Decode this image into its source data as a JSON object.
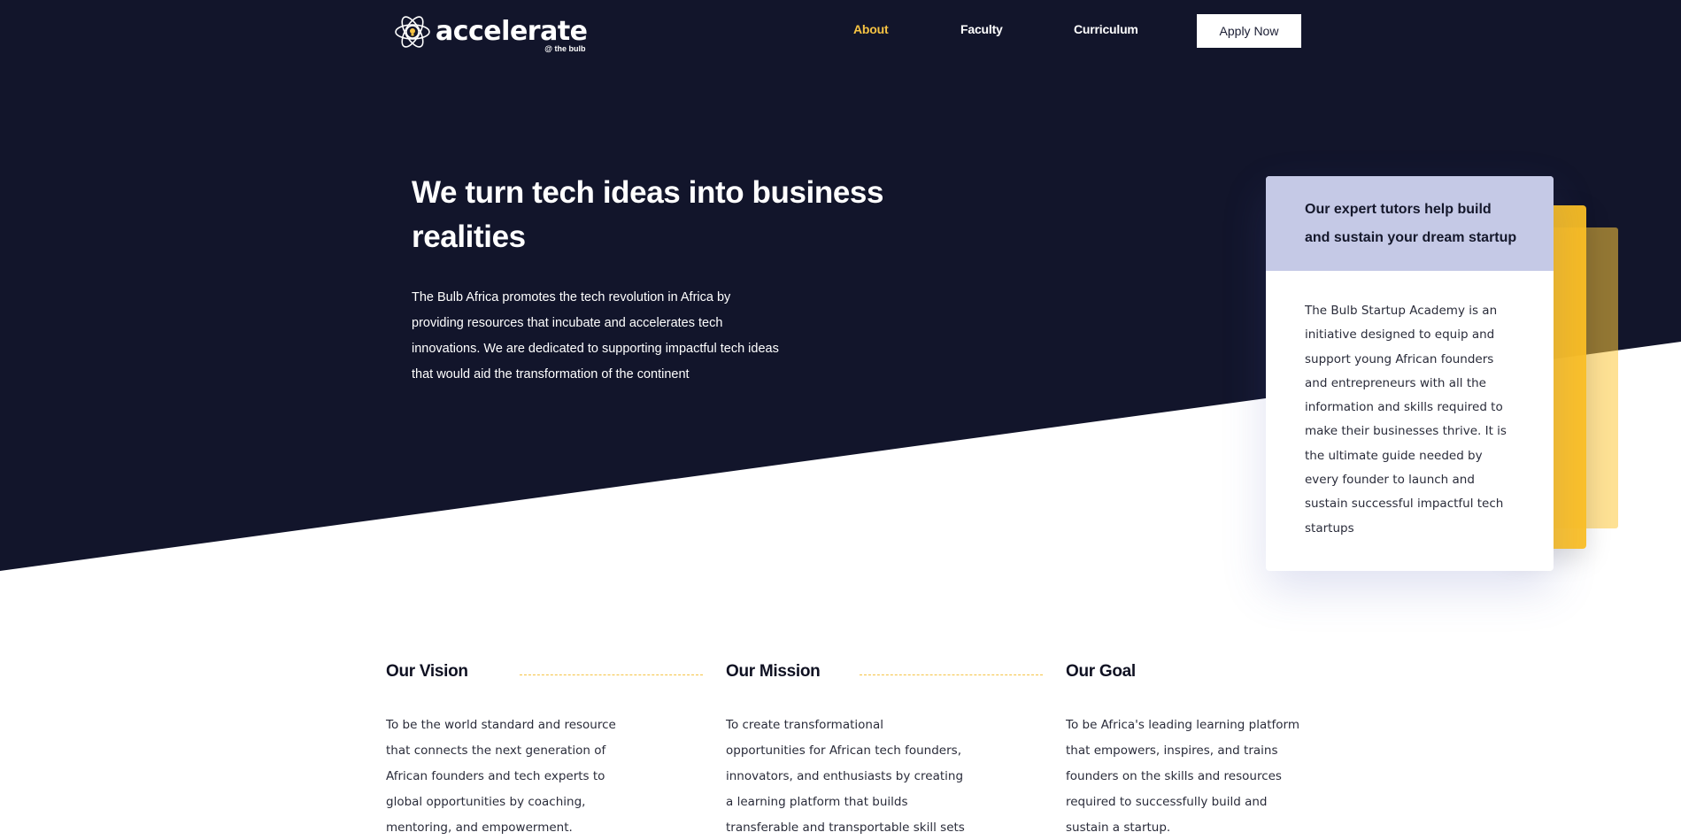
{
  "nav": {
    "logo": {
      "word": "accelerate",
      "sub": "@ the bulb"
    },
    "links": [
      "About",
      "Faculty",
      "Curriculum"
    ],
    "active_link": "About",
    "apply_label": "Apply Now"
  },
  "hero": {
    "title_line1": "We turn tech ideas into business",
    "title_line2": "realities",
    "text_lines": [
      "The Bulb Africa promotes the tech revolution in Africa by",
      "providing resources that incubate and accelerates tech",
      "innovations. We are dedicated to supporting impactful tech ideas",
      "that would aid the transformation of the continent"
    ]
  },
  "card": {
    "heading_lines": [
      "Our expert tutors help build",
      "and sustain your dream startup"
    ],
    "body_lines": [
      "The Bulb Startup Academy is an",
      "initiative designed to equip and",
      "support young African founders",
      "and entrepreneurs with all the",
      "information and skills required to",
      "make their businesses thrive. It is",
      "the ultimate guide needed by",
      "every founder to launch and",
      "sustain successful impactful tech",
      "startups"
    ]
  },
  "columns": [
    {
      "title": "Our Vision",
      "lines": [
        "To be the world standard and resource",
        "that connects the next generation of",
        "African founders and tech experts to",
        "global opportunities by coaching,",
        "mentoring, and empowerment."
      ]
    },
    {
      "title": "Our Mission",
      "lines": [
        "To create transformational",
        "opportunities for African tech founders,",
        "innovators, and enthusiasts by creating",
        "a learning platform that builds",
        "transferable and transportable skill sets"
      ]
    },
    {
      "title": "Our Goal",
      "lines": [
        "To be Africa's leading learning platform",
        "that empowers, inspires, and trains",
        "founders on the skills and resources",
        "required to successfully build and",
        "sustain a startup."
      ]
    }
  ],
  "colors": {
    "navy": "#12152b",
    "accent_yellow": "#f6c343",
    "card_header": "#c5c9e6"
  },
  "icons": {
    "logo": "atom-bulb-icon"
  }
}
